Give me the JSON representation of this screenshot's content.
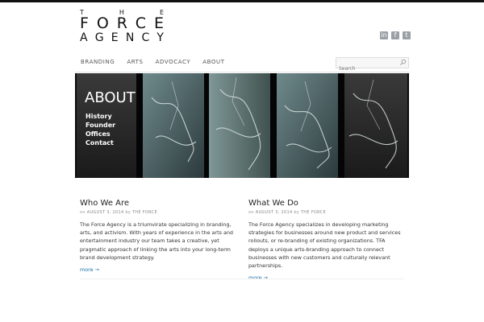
{
  "logo": {
    "the": [
      "T",
      "H",
      "E"
    ],
    "force": [
      "F",
      "O",
      "R",
      "C",
      "E"
    ],
    "agency": [
      "A",
      "G",
      "E",
      "N",
      "C",
      "Y"
    ]
  },
  "social": {
    "linkedin": "in",
    "facebook": "f",
    "twitter": "t"
  },
  "nav": [
    "BRANDING",
    "ARTS",
    "ADVOCACY",
    "ABOUT"
  ],
  "search": {
    "placeholder": "Search"
  },
  "hero": {
    "title": "ABOUT",
    "links": [
      "History",
      "Founder",
      "Offices",
      "Contact"
    ]
  },
  "posts": [
    {
      "title": "Who We Are",
      "meta_on": "on",
      "date": "AUGUST 3, 2014",
      "meta_by": "by",
      "author": "THE FORCE",
      "body": "The Force Agency is a triumvirate specializing in branding, arts, and activism. With years of experience in the arts and entertainment industry our team takes a creative, yet pragmatic approach of linking the arts into your long-term brand development strategy.",
      "more": "more →"
    },
    {
      "title": "What We Do",
      "meta_on": "on",
      "date": "AUGUST 3, 2014",
      "meta_by": "by",
      "author": "THE FORCE",
      "body": "The Force Agency specializes in developing marketing strategies for businesses around new product and services rollouts, or re-branding of existing organizations. TFA deploys a unique arts-branding approach to connect businesses with new customers and culturally relevant partnerships.",
      "more": "more →"
    }
  ]
}
